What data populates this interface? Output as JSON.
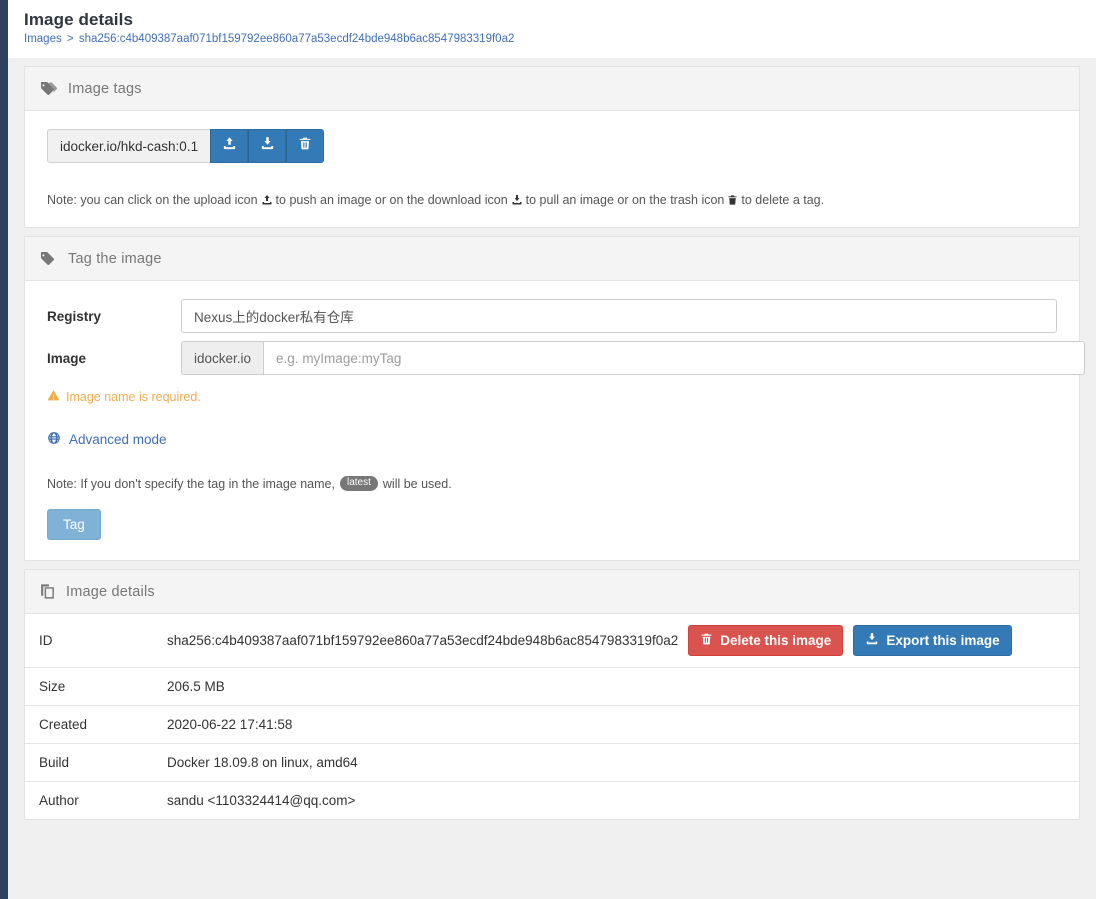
{
  "header": {
    "title": "Image details",
    "breadcrumb": {
      "root": "Images",
      "separator": ">",
      "current": "sha256:c4b409387aaf071bf159792ee860a77a53ecdf24bde948b6ac8547983319f0a2"
    }
  },
  "image_tags_panel": {
    "title": "Image tags",
    "icon": "tags-icon",
    "tags": [
      {
        "name": "idocker.io/hkd-cash:0.1",
        "actions": [
          {
            "icon": "upload-icon",
            "title": "push"
          },
          {
            "icon": "download-icon",
            "title": "pull"
          },
          {
            "icon": "trash-icon",
            "title": "delete"
          }
        ]
      }
    ],
    "note_part1": "Note: you can click on the upload icon",
    "note_part2": "to push an image or on the download icon",
    "note_part3": "to pull an image or on the trash icon",
    "note_part4": "to delete a tag."
  },
  "tag_image_panel": {
    "title": "Tag the image",
    "icon": "tag-icon",
    "registry_label": "Registry",
    "registry_value": "Nexus上的docker私有仓库",
    "image_label": "Image",
    "image_addon": "idocker.io",
    "image_placeholder": "e.g. myImage:myTag",
    "image_value": "",
    "error_text": "Image name is required.",
    "error_icon": "warning-triangle-icon",
    "advanced_mode_label": "Advanced mode",
    "advanced_mode_icon": "globe-icon",
    "note_prefix": "Note: If you don't specify the tag in the image name,",
    "note_badge": "latest",
    "note_suffix": "will be used.",
    "tag_button_label": "Tag"
  },
  "image_details_panel": {
    "title": "Image details",
    "icon": "clone-icon",
    "rows": [
      {
        "key": "ID",
        "value": "sha256:c4b409387aaf071bf159792ee860a77a53ecdf24bde948b6ac8547983319f0a2"
      },
      {
        "key": "Size",
        "value": "206.5 MB"
      },
      {
        "key": "Created",
        "value": "2020-06-22 17:41:58"
      },
      {
        "key": "Build",
        "value": "Docker 18.09.8 on linux, amd64"
      },
      {
        "key": "Author",
        "value": "sandu <1103324414@qq.com>"
      }
    ],
    "delete_button_label": "Delete this image",
    "delete_button_icon": "trash-icon",
    "export_button_label": "Export this image",
    "export_button_icon": "download-icon"
  },
  "colors": {
    "rail": "#30405f",
    "primary": "#337ab7",
    "danger": "#d9534f",
    "warning": "#f0ad4e",
    "link": "#3e6fb5",
    "page_bg": "#f0f0f0"
  }
}
